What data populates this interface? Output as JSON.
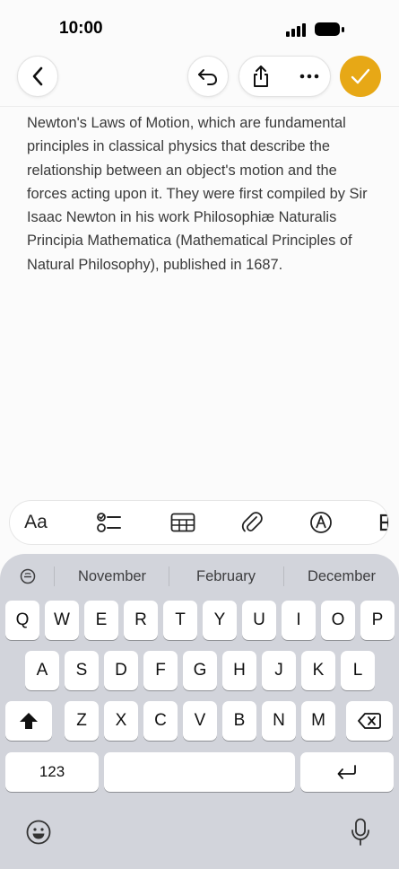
{
  "status_bar": {
    "time": "10:00"
  },
  "note": {
    "text": "Newton's Laws of Motion, which are fundamental principles in classical physics that describe the relationship between an object's motion and the forces acting upon it. They were first compiled by Sir Isaac Newton in his work Philosophiæ Naturalis Principia Mathematica (Mathematical Principles of Natural Philosophy), published in 1687."
  },
  "format_bar": {
    "text_style_label": "Aa"
  },
  "keyboard": {
    "suggestions": [
      "November",
      "February",
      "December"
    ],
    "row1": [
      "Q",
      "W",
      "E",
      "R",
      "T",
      "Y",
      "U",
      "I",
      "O",
      "P"
    ],
    "row2": [
      "A",
      "S",
      "D",
      "F",
      "G",
      "H",
      "J",
      "K",
      "L"
    ],
    "row3": [
      "Z",
      "X",
      "C",
      "V",
      "B",
      "N",
      "M"
    ],
    "numbers_label": "123"
  },
  "colors": {
    "accent": "#e7a816",
    "keyboard_bg": "#d2d4db"
  }
}
